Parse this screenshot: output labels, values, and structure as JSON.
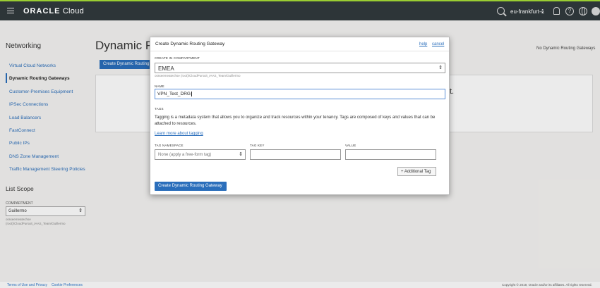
{
  "topbar": {
    "brand_main": "ORACLE",
    "brand_sub": "Cloud",
    "region": "eu-frankfurt-1",
    "help_glyph": "?"
  },
  "sidebar": {
    "title": "Networking",
    "items": [
      {
        "label": "Virtual Cloud Networks"
      },
      {
        "label": "Dynamic Routing Gateways"
      },
      {
        "label": "Customer-Premises Equipment"
      },
      {
        "label": "IPSec Connections"
      },
      {
        "label": "Load Balancers"
      },
      {
        "label": "FastConnect"
      },
      {
        "label": "Public IPs"
      },
      {
        "label": "DNS Zone Management"
      },
      {
        "label": "Traffic Management Steering Policies"
      }
    ],
    "active_index": 1,
    "scope": {
      "title": "List Scope",
      "compartment_label": "COMPARTMENT",
      "compartment_value": "Guillermo",
      "compartment_path": "oraseemeatechse (root)/CloudPursuit_IAAS_Team/Guillermo"
    }
  },
  "page": {
    "title": "Dynamic R",
    "create_button": "Create Dynamic Routing",
    "no_items": "No Dynamic Routing Gateways",
    "partial_text": "t."
  },
  "modal": {
    "title": "Create Dynamic Routing Gateway",
    "help_link": "help",
    "cancel_link": "cancel",
    "compartment_label": "CREATE IN COMPARTMENT",
    "compartment_value": "EMEA",
    "compartment_path": "oraseemeatechse (root)/CloudPursuit_IAAS_Team/Guillermo",
    "name_label": "NAME",
    "name_value": "VPN_Test_DRG",
    "tags_label": "TAGS",
    "tags_description": "Tagging is a metadata system that allows you to organize and track resources within your tenancy. Tags are composed of keys and values that can be attached to resources.",
    "learn_more": "Learn more about tagging",
    "tag_namespace_label": "TAG NAMESPACE",
    "tag_namespace_value": "None (apply a free-form tag)",
    "tag_key_label": "TAG KEY",
    "tag_key_value": "",
    "value_label": "VALUE",
    "value_value": "",
    "add_tag_button": "+ Additional Tag",
    "submit_button": "Create Dynamic Routing Gateway"
  },
  "footer": {
    "terms": "Terms of Use and Privacy",
    "cookies": "Cookie Preferences",
    "copyright": "Copyright © 2019, Oracle and/or its affiliates. All rights reserved."
  },
  "colors": {
    "topbar": "#2d3538",
    "accent_blue": "#2a6ebb",
    "topbar_stripe": "#9acd32"
  }
}
